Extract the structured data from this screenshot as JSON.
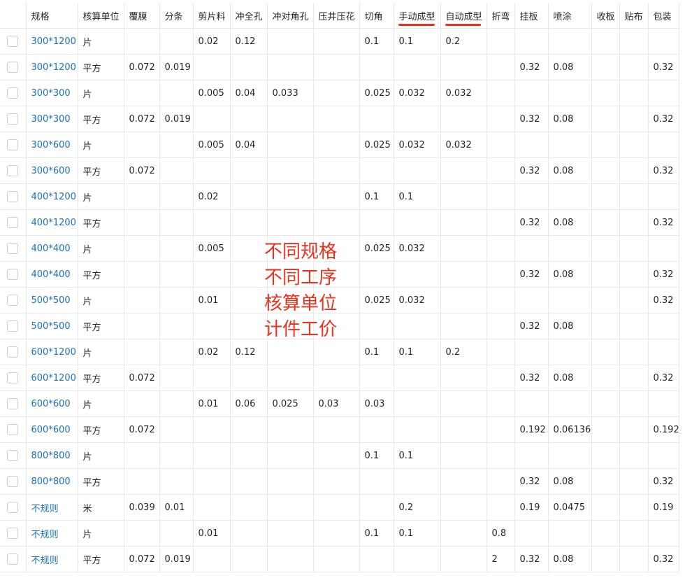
{
  "table": {
    "columns": [
      "规格",
      "核算单位",
      "覆膜",
      "分条",
      "剪片料",
      "冲全孔",
      "冲对角孔",
      "压井压花",
      "切角",
      "手动成型",
      "自动成型",
      "折弯",
      "挂板",
      "喷涂",
      "收板",
      "贴布",
      "包装"
    ],
    "highlighted_columns": [
      "手动成型",
      "自动成型"
    ],
    "rows": [
      [
        "300*1200",
        "片",
        "",
        "",
        "0.02",
        "0.12",
        "",
        "",
        "0.1",
        "0.1",
        "0.2",
        "",
        "",
        "",
        "",
        "",
        ""
      ],
      [
        "300*1200",
        "平方",
        "0.072",
        "0.019",
        "",
        "",
        "",
        "",
        "",
        "",
        "",
        "",
        "0.32",
        "0.08",
        "",
        "",
        "0.32"
      ],
      [
        "300*300",
        "片",
        "",
        "",
        "0.005",
        "0.04",
        "0.033",
        "",
        "0.025",
        "0.032",
        "0.032",
        "",
        "",
        "",
        "",
        "",
        ""
      ],
      [
        "300*300",
        "平方",
        "0.072",
        "0.019",
        "",
        "",
        "",
        "",
        "",
        "",
        "",
        "",
        "0.32",
        "0.08",
        "",
        "",
        "0.32"
      ],
      [
        "300*600",
        "片",
        "",
        "",
        "0.005",
        "0.04",
        "",
        "",
        "0.025",
        "0.032",
        "0.032",
        "",
        "",
        "",
        "",
        "",
        ""
      ],
      [
        "300*600",
        "平方",
        "0.072",
        "",
        "",
        "",
        "",
        "",
        "",
        "",
        "",
        "",
        "0.32",
        "0.08",
        "",
        "",
        "0.32"
      ],
      [
        "400*1200",
        "片",
        "",
        "",
        "0.02",
        "",
        "",
        "",
        "0.1",
        "0.1",
        "",
        "",
        "",
        "",
        "",
        "",
        ""
      ],
      [
        "400*1200",
        "平方",
        "",
        "",
        "",
        "",
        "",
        "",
        "",
        "",
        "",
        "",
        "0.32",
        "0.08",
        "",
        "",
        "0.32"
      ],
      [
        "400*400",
        "片",
        "",
        "",
        "0.005",
        "",
        "",
        "",
        "0.025",
        "0.032",
        "",
        "",
        "",
        "",
        "",
        "",
        ""
      ],
      [
        "400*400",
        "平方",
        "",
        "",
        "",
        "",
        "",
        "",
        "",
        "",
        "",
        "",
        "0.32",
        "0.08",
        "",
        "",
        "0.32"
      ],
      [
        "500*500",
        "片",
        "",
        "",
        "0.01",
        "",
        "",
        "",
        "0.025",
        "0.032",
        "",
        "",
        "",
        "",
        "",
        "",
        "0.32"
      ],
      [
        "500*500",
        "平方",
        "",
        "",
        "",
        "",
        "",
        "",
        "",
        "",
        "",
        "",
        "0.32",
        "0.08",
        "",
        "",
        ""
      ],
      [
        "600*1200",
        "片",
        "",
        "",
        "0.02",
        "0.12",
        "",
        "",
        "0.1",
        "0.1",
        "0.2",
        "",
        "",
        "",
        "",
        "",
        ""
      ],
      [
        "600*1200",
        "平方",
        "0.072",
        "",
        "",
        "",
        "",
        "",
        "",
        "",
        "",
        "",
        "0.32",
        "0.08",
        "",
        "",
        "0.32"
      ],
      [
        "600*600",
        "片",
        "",
        "",
        "0.01",
        "0.06",
        "0.025",
        "0.03",
        "0.03",
        "",
        "",
        "",
        "",
        "",
        "",
        "",
        ""
      ],
      [
        "600*600",
        "平方",
        "0.072",
        "",
        "",
        "",
        "",
        "",
        "",
        "",
        "",
        "",
        "0.192",
        "0.06136",
        "",
        "",
        "0.192"
      ],
      [
        "800*800",
        "片",
        "",
        "",
        "",
        "",
        "",
        "",
        "0.1",
        "0.1",
        "",
        "",
        "",
        "",
        "",
        "",
        ""
      ],
      [
        "800*800",
        "平方",
        "",
        "",
        "",
        "",
        "",
        "",
        "",
        "",
        "",
        "",
        "0.32",
        "0.08",
        "",
        "",
        "0.32"
      ],
      [
        "不规则",
        "米",
        "0.039",
        "0.01",
        "",
        "",
        "",
        "",
        "",
        "0.2",
        "",
        "",
        "0.19",
        "0.0475",
        "",
        "",
        "0.19"
      ],
      [
        "不规则",
        "片",
        "",
        "",
        "0.01",
        "",
        "",
        "",
        "0.1",
        "0.1",
        "",
        "0.8",
        "",
        "",
        "",
        "",
        ""
      ],
      [
        "不规则",
        "平方",
        "0.072",
        "0.019",
        "",
        "",
        "",
        "",
        "",
        "",
        "",
        "2",
        "0.32",
        "0.08",
        "",
        "",
        "0.32"
      ]
    ]
  },
  "annotation": {
    "lines": [
      "不同规格",
      "不同工序",
      "核算单位",
      "计件工价"
    ],
    "color": "#e8321d"
  },
  "colors": {
    "link": "#1a72b8",
    "grid": "#e8e8e8",
    "highlight": "#e8321d"
  }
}
